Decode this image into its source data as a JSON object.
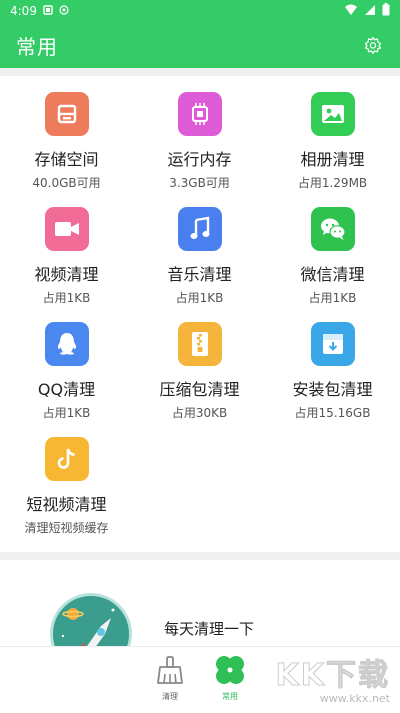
{
  "status": {
    "time": "4:09"
  },
  "header": {
    "title": "常用"
  },
  "items": [
    {
      "label": "存储空间",
      "sub": "40.0GB可用",
      "color": "#ee7b5c",
      "icon": "storage-icon"
    },
    {
      "label": "运行内存",
      "sub": "3.3GB可用",
      "color": "#de5bd8",
      "icon": "memory-chip-icon"
    },
    {
      "label": "相册清理",
      "sub": "占用1.29MB",
      "color": "#33cc55",
      "icon": "photo-icon"
    },
    {
      "label": "视频清理",
      "sub": "占用1KB",
      "color": "#f06b96",
      "icon": "video-camera-icon"
    },
    {
      "label": "音乐清理",
      "sub": "占用1KB",
      "color": "#4a7ff0",
      "icon": "music-note-icon"
    },
    {
      "label": "微信清理",
      "sub": "占用1KB",
      "color": "#2fc24f",
      "icon": "wechat-icon"
    },
    {
      "label": "QQ清理",
      "sub": "占用1KB",
      "color": "#4a88f0",
      "icon": "qq-penguin-icon"
    },
    {
      "label": "压缩包清理",
      "sub": "占用30KB",
      "color": "#f5b53b",
      "icon": "zip-archive-icon"
    },
    {
      "label": "安装包清理",
      "sub": "占用15.16GB",
      "color": "#3aa7e8",
      "icon": "install-package-icon"
    },
    {
      "label": "短视频清理",
      "sub": "清理短视频缓存",
      "color": "#f7b733",
      "icon": "tiktok-icon"
    }
  ],
  "promo": {
    "text": "每天清理一下"
  },
  "tabs": [
    {
      "label": "清理",
      "icon": "broom-icon",
      "active": false
    },
    {
      "label": "常用",
      "icon": "clover-icon",
      "active": true
    }
  ],
  "watermark": {
    "logo": "KK下载",
    "url": "www.kkx.net"
  }
}
